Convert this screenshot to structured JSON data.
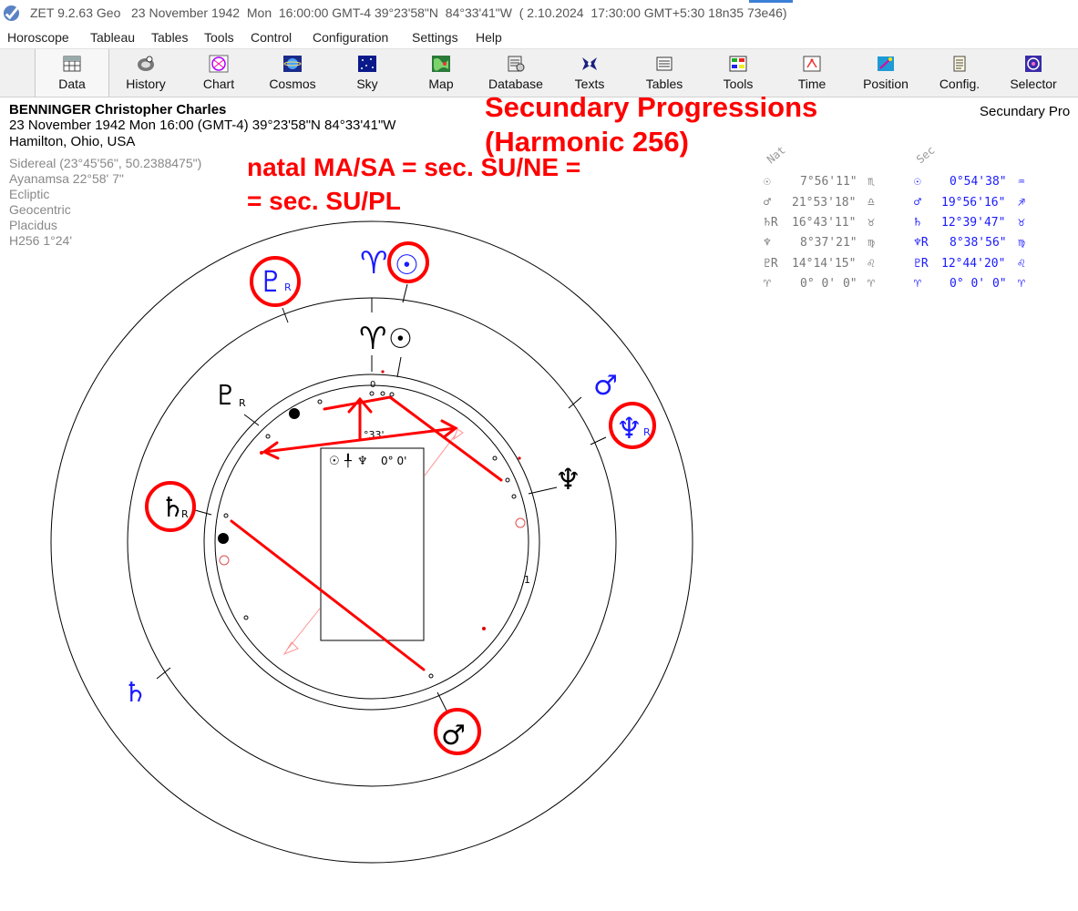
{
  "window": {
    "title": "ZET 9.2.63 Geo   23 November 1942  Mon  16:00:00 GMT-4 39°23'58\"N  84°33'41\"W  ( 2.10.2024  17:30:00 GMT+5:30 18n35 73e46)"
  },
  "menu": [
    "Horoscope",
    "Tableau",
    "Tables",
    "Tools",
    "Control",
    "Configuration",
    "Settings",
    "Help"
  ],
  "toolbar": [
    {
      "label": "Data",
      "icon": "data-grid-icon"
    },
    {
      "label": "History",
      "icon": "history-disc-icon"
    },
    {
      "label": "Chart",
      "icon": "chart-wheel-icon"
    },
    {
      "label": "Cosmos",
      "icon": "cosmos-icon"
    },
    {
      "label": "Sky",
      "icon": "sky-stars-icon"
    },
    {
      "label": "Map",
      "icon": "map-icon"
    },
    {
      "label": "Database",
      "icon": "database-icon"
    },
    {
      "label": "Texts",
      "icon": "texts-icon"
    },
    {
      "label": "Tables",
      "icon": "tables-icon"
    },
    {
      "label": "Tools",
      "icon": "tools-icon"
    },
    {
      "label": "Time",
      "icon": "time-icon"
    },
    {
      "label": "Position",
      "icon": "position-icon"
    },
    {
      "label": "Config.",
      "icon": "config-icon"
    },
    {
      "label": "Selector",
      "icon": "selector-icon"
    }
  ],
  "person": {
    "name": "BENNINGER Christopher Charles",
    "datetime": "23 November 1942  Mon  16:00 (GMT-4) 39°23'58\"N  84°33'41\"W",
    "place": "Hamilton, Ohio, USA"
  },
  "settings": [
    "Sidereal (23°45'56\", 50.2388475\")",
    "Ayanamsa 22°58' 7\"",
    "Ecliptic",
    "Geocentric",
    "Placidus",
    "H256   1°24'"
  ],
  "annotations": {
    "title_line1": "Secundary Progressions",
    "title_line2": "(Harmonic 256)",
    "formula_line1": "natal MA/SA = sec. SU/NE =",
    "formula_line2": "= sec. SU/PL"
  },
  "right_title": "Secundary Pro",
  "table": {
    "nat_header": "Nat",
    "sec_header": "Sec",
    "rows": [
      {
        "nat_sym": "☉",
        "nat_val": "7°56'11\"",
        "nat_sign": "♏",
        "sec_sym": "☉",
        "sec_val": "0°54'38\"",
        "sec_sign": "♒"
      },
      {
        "nat_sym": "♂",
        "nat_val": "21°53'18\"",
        "nat_sign": "♎",
        "sec_sym": "♂",
        "sec_val": "19°56'16\"",
        "sec_sign": "♐"
      },
      {
        "nat_sym": "♄R",
        "nat_val": "16°43'11\"",
        "nat_sign": "♉",
        "sec_sym": "♄",
        "sec_val": "12°39'47\"",
        "sec_sign": "♉"
      },
      {
        "nat_sym": "♆",
        "nat_val": "8°37'21\"",
        "nat_sign": "♍",
        "sec_sym": "♆R",
        "sec_val": "8°38'56\"",
        "sec_sign": "♍"
      },
      {
        "nat_sym": "♇R",
        "nat_val": "14°14'15\"",
        "nat_sign": "♌",
        "sec_sym": "♇R",
        "sec_val": "12°44'20\"",
        "sec_sign": "♌"
      },
      {
        "nat_sym": "♈",
        "nat_val": "0° 0' 0\"",
        "nat_sign": "♈",
        "sec_sym": "♈",
        "sec_val": "0° 0' 0\"",
        "sec_sign": "♈"
      }
    ]
  },
  "wheel": {
    "glyphs": {
      "sec_aries": "♈",
      "sec_sun": "☉",
      "sec_pluto": "♇",
      "sec_pluto_r": "R",
      "sec_mars": "♂",
      "sec_neptune": "♆",
      "sec_neptune_r": "R",
      "sec_saturn": "♄",
      "sec_saturn_r": "R",
      "nat_aries": "♈",
      "nat_sun": "☉",
      "nat_pluto": "♇",
      "nat_pluto_r": "R",
      "nat_neptune": "♆",
      "nat_mars": "♂"
    },
    "labels": {
      "zero": "0",
      "one": "1",
      "arc_label": "°33'"
    },
    "info_box": {
      "sym1": "☉",
      "sep": "╀",
      "sym2": "♆",
      "value": "0° 0'"
    }
  },
  "colors": {
    "sec": "#1a1aff",
    "annotation": "#ff0000",
    "natal": "#000000",
    "gray": "#777777"
  }
}
